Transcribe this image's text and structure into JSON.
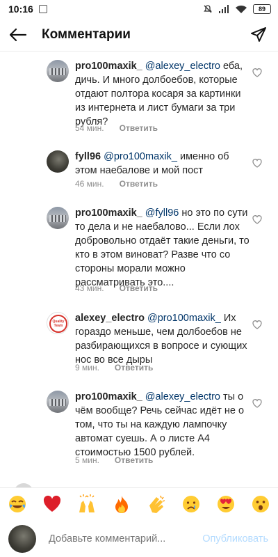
{
  "status": {
    "time": "10:16",
    "battery": "89"
  },
  "header": {
    "title": "Комментарии"
  },
  "comments": [
    {
      "user": "pro100maxik_",
      "mention": "@alexey_electro",
      "text": " еба, дичь. И много долбоебов, которые отдают полтора косаря за картинки из интернета и лист бумаги за три рубля?",
      "time": "54 мин.",
      "reply": "Ответить",
      "avatar": "building"
    },
    {
      "user": "fyll96",
      "mention": "@pro100maxik_",
      "text": " именно об этом наебалове и мой пост",
      "time": "46 мин.",
      "reply": "Ответить",
      "avatar": "dark"
    },
    {
      "user": "pro100maxik_",
      "mention": "@fyll96",
      "text": " но это по сути то дела и не наебалово... Если лох добровольно отдаёт такие деньги, то кто в этом виноват? Разве что со стороны морали можно рассматривать это....",
      "time": "43 мин.",
      "reply": "Ответить",
      "avatar": "building"
    },
    {
      "user": "alexey_electro",
      "mention": "@pro100maxik_",
      "text": " Их гораздо меньше, чем долбоебов не разбирающихся в вопросе и сующих нос во все дыры",
      "time": "9 мин.",
      "reply": "Ответить",
      "avatar": "badge",
      "avatar_text": "Quality Team"
    },
    {
      "user": "pro100maxik_",
      "mention": "@alexey_electro",
      "text": " ты о чём вообще? Речь сейчас идёт не о том, что ты на каждую лампочку автомат суешь. А о листе А4 стоимостью 1500 рублей.",
      "time": "5 мин.",
      "reply": "Ответить",
      "avatar": "building"
    }
  ],
  "emojis": [
    {
      "name": "joy-emoji",
      "glyph": "😂"
    },
    {
      "name": "heart-emoji",
      "glyph": "❤️"
    },
    {
      "name": "raised-hands-emoji",
      "glyph": "🙌"
    },
    {
      "name": "fire-emoji",
      "glyph": "🔥"
    },
    {
      "name": "clap-emoji",
      "glyph": "👏"
    },
    {
      "name": "crying-emoji",
      "glyph": "😢"
    },
    {
      "name": "heart-eyes-emoji",
      "glyph": "😍"
    },
    {
      "name": "astonished-emoji",
      "glyph": "😮"
    }
  ],
  "input": {
    "placeholder": "Добавьте комментарий...",
    "post_label": "Опубликовать"
  },
  "colors": {
    "mention": "#003569",
    "meta": "#8e8e8e",
    "post_disabled": "#b3dbff"
  }
}
